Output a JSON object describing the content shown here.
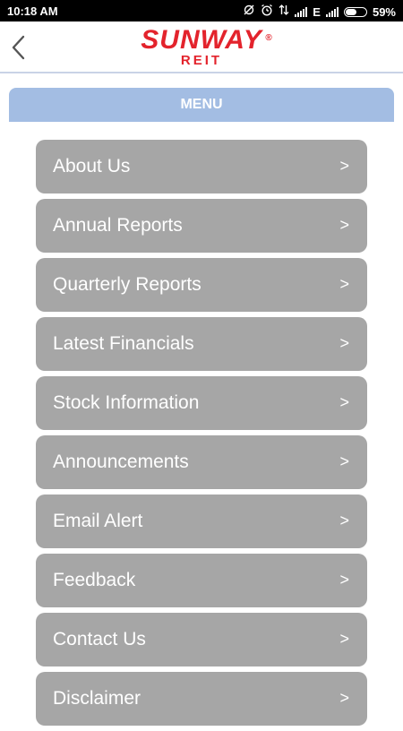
{
  "status_bar": {
    "time": "10:18 AM",
    "network": "E",
    "battery_percent": "59%",
    "battery_level": 0.59,
    "icons": [
      "sync-off-icon",
      "alarm-icon",
      "data-transfer-icon",
      "signal-icon",
      "network-type-icon",
      "signal-icon",
      "battery-icon"
    ]
  },
  "header": {
    "back_icon": "chevron-left-icon",
    "logo_text": "SUNWAY",
    "logo_registered": "®",
    "logo_sub": "REIT",
    "brand_color": "#e3232c"
  },
  "menu": {
    "title": "MENU",
    "bar_color": "#a3bde3",
    "item_color": "#a6a6a6",
    "chevron": ">",
    "items": [
      {
        "label": "About Us"
      },
      {
        "label": "Annual Reports"
      },
      {
        "label": "Quarterly Reports"
      },
      {
        "label": "Latest Financials"
      },
      {
        "label": "Stock Information"
      },
      {
        "label": "Announcements"
      },
      {
        "label": "Email Alert"
      },
      {
        "label": "Feedback"
      },
      {
        "label": "Contact Us"
      },
      {
        "label": "Disclaimer"
      }
    ]
  }
}
